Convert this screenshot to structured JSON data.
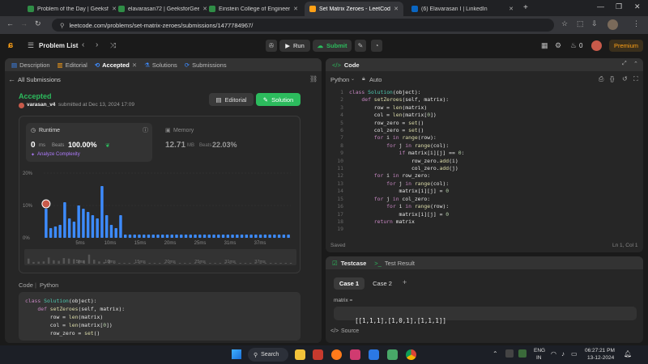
{
  "browser": {
    "tabs": [
      {
        "label": "Problem of the Day | GeeksforG",
        "color": "#2f8d46",
        "active": false
      },
      {
        "label": "elavarasan72 | GeeksforGeeks |",
        "color": "#2f8d46",
        "active": false
      },
      {
        "label": "Einstein College of Engineering",
        "color": "#2f8d46",
        "active": false
      },
      {
        "label": "Set Matrix Zeroes - LeetCode",
        "color": "#ffa116",
        "active": true
      },
      {
        "label": "(6) Elavarasan I | LinkedIn",
        "color": "#0a66c2",
        "active": false
      }
    ],
    "url": "leetcode.com/problems/set-matrix-zeroes/submissions/1477784967/"
  },
  "nav": {
    "problem_list": "Problem List",
    "run": "Run",
    "submit": "Submit",
    "streak": "0",
    "premium": "Premium"
  },
  "left": {
    "tabs": [
      "Description",
      "Editorial",
      "Accepted",
      "Solutions",
      "Submissions"
    ],
    "all_submissions": "All Submissions",
    "status": "Accepted",
    "user": "varasan_v4",
    "submitted": "submitted at Dec 13, 2024 17:09",
    "editorial_btn": "Editorial",
    "solution_btn": "Solution",
    "runtime": {
      "label": "Runtime",
      "value": "0",
      "unit": "ms",
      "beats_label": "Beats",
      "beats": "100.00%",
      "analyze": "Analyze Complexity"
    },
    "memory": {
      "label": "Memory",
      "value": "12.71",
      "unit": "MB",
      "beats_label": "Beats",
      "beats": "22.03%"
    },
    "code_label": "Code",
    "lang": "Python"
  },
  "chart_data": {
    "type": "bar",
    "ylabels": [
      "20%",
      "10%",
      "0%"
    ],
    "xlabels": [
      "5ms",
      "10ms",
      "15ms",
      "20ms",
      "25ms",
      "31ms",
      "37ms"
    ],
    "values": [
      9,
      3,
      3.5,
      4,
      11,
      6,
      5,
      10,
      9,
      8,
      7,
      6,
      16,
      7,
      4,
      3,
      7,
      1,
      1,
      1,
      1,
      1,
      1,
      1,
      1,
      1,
      1,
      1,
      1,
      1,
      1,
      1,
      1,
      1,
      1,
      1,
      1,
      1,
      1,
      1,
      1,
      1,
      1,
      1,
      1,
      1,
      1,
      1,
      1,
      1,
      1,
      1,
      1
    ],
    "highlight_index": 0,
    "ylim": [
      0,
      20
    ]
  },
  "left_code": [
    "class Solution(object):",
    "    def setZeroes(self, matrix):",
    "        row = len(matrix)",
    "        col = len(matrix[0])",
    "        row_zero = set()"
  ],
  "editor": {
    "title": "Code",
    "lang": "Python",
    "auto": "Auto",
    "lines": [
      "class Solution(object):",
      "    def setZeroes(self, matrix):",
      "        row = len(matrix)",
      "        col = len(matrix[0])",
      "        row_zero = set()",
      "        col_zero = set()",
      "        for i in range(row):",
      "            for j in range(col):",
      "                if matrix[i][j] == 0:",
      "                    row_zero.add(i)",
      "                    col_zero.add(j)",
      "        for i in row_zero:",
      "            for j in range(col):",
      "                matrix[i][j] = 0",
      "        for j in col_zero:",
      "            for i in range(row):",
      "                matrix[i][j] = 0",
      "        return matrix",
      ""
    ],
    "saved": "Saved",
    "position": "Ln 1, Col 1"
  },
  "testcase": {
    "tab1": "Testcase",
    "tab2": "Test Result",
    "case1": "Case 1",
    "case2": "Case 2",
    "var": "matrix =",
    "value": "[[1,1,1],[1,0,1],[1,1,1]]",
    "source": "Source"
  },
  "taskbar": {
    "search": "Search",
    "lang1": "ENG",
    "lang2": "IN",
    "time": "06:27:21 PM",
    "date": "13-12-2024"
  }
}
